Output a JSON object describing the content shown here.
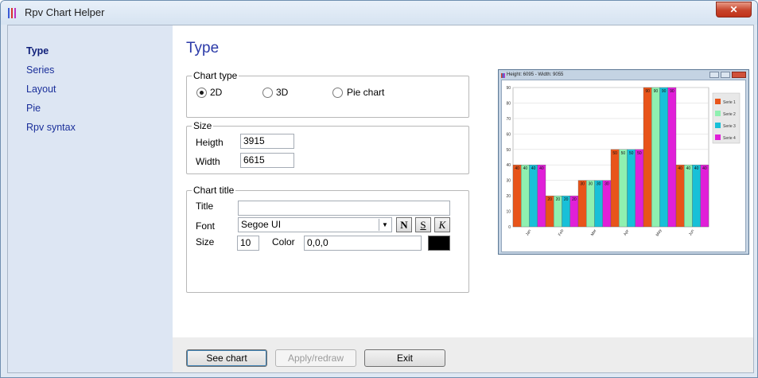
{
  "window": {
    "title": "Rpv Chart Helper",
    "close_glyph": "✕"
  },
  "sidebar": {
    "items": [
      {
        "label": "Type",
        "active": true
      },
      {
        "label": "Series",
        "active": false
      },
      {
        "label": "Layout",
        "active": false
      },
      {
        "label": "Pie",
        "active": false
      },
      {
        "label": "Rpv syntax",
        "active": false
      }
    ]
  },
  "page": {
    "title": "Type"
  },
  "chart_type": {
    "legend": "Chart type",
    "options": [
      {
        "label": "2D",
        "checked": true
      },
      {
        "label": "3D",
        "checked": false
      },
      {
        "label": "Pie chart",
        "checked": false
      }
    ]
  },
  "size": {
    "legend": "Size",
    "height_label": "Heigth",
    "height_value": "3915",
    "width_label": "Width",
    "width_value": "6615"
  },
  "chart_title": {
    "legend": "Chart title",
    "title_label": "Title",
    "title_value": "",
    "font_label": "Font",
    "font_value": "Segoe UI",
    "bold_glyph": "N",
    "underline_glyph": "S",
    "italic_glyph": "K",
    "size_label": "Size",
    "size_value": "10",
    "color_label": "Color",
    "color_value": "0,0,0",
    "swatch_color": "#000000"
  },
  "buttons": {
    "see_chart": "See chart",
    "apply": "Apply/redraw",
    "exit": "Exit"
  },
  "preview": {
    "title": "Height: 6095 - Width: 9055",
    "chart_data": {
      "type": "bar",
      "categories": [
        "Jan",
        "Feb",
        "Mar",
        "Apr",
        "May",
        "Jun"
      ],
      "series": [
        {
          "name": "Serie 1",
          "values": [
            40,
            20,
            30,
            50,
            90,
            40
          ],
          "color": "#e8541a"
        },
        {
          "name": "Serie 2",
          "values": [
            40,
            20,
            30,
            50,
            90,
            40
          ],
          "color": "#8ff0b0"
        },
        {
          "name": "Serie 3",
          "values": [
            40,
            20,
            30,
            50,
            90,
            40
          ],
          "color": "#18c0d8"
        },
        {
          "name": "Serie 4",
          "values": [
            40,
            20,
            30,
            50,
            90,
            40
          ],
          "color": "#e020d8"
        }
      ],
      "ylim": [
        0,
        90
      ],
      "yticks": [
        0,
        10,
        20,
        30,
        40,
        50,
        60,
        70,
        80,
        90
      ],
      "grid": true,
      "legend_position": "right"
    }
  }
}
